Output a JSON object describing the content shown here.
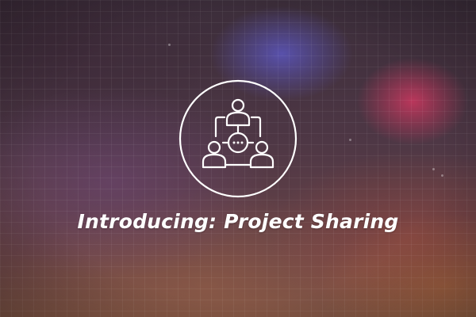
{
  "banner": {
    "headline": "Introducing: Project Sharing",
    "icon": "project-sharing-people-network-icon"
  },
  "colors": {
    "icon_stroke": "#ffffff",
    "text": "#ffffff",
    "accent_blue": "#5c56be",
    "accent_red": "#cd375f"
  }
}
